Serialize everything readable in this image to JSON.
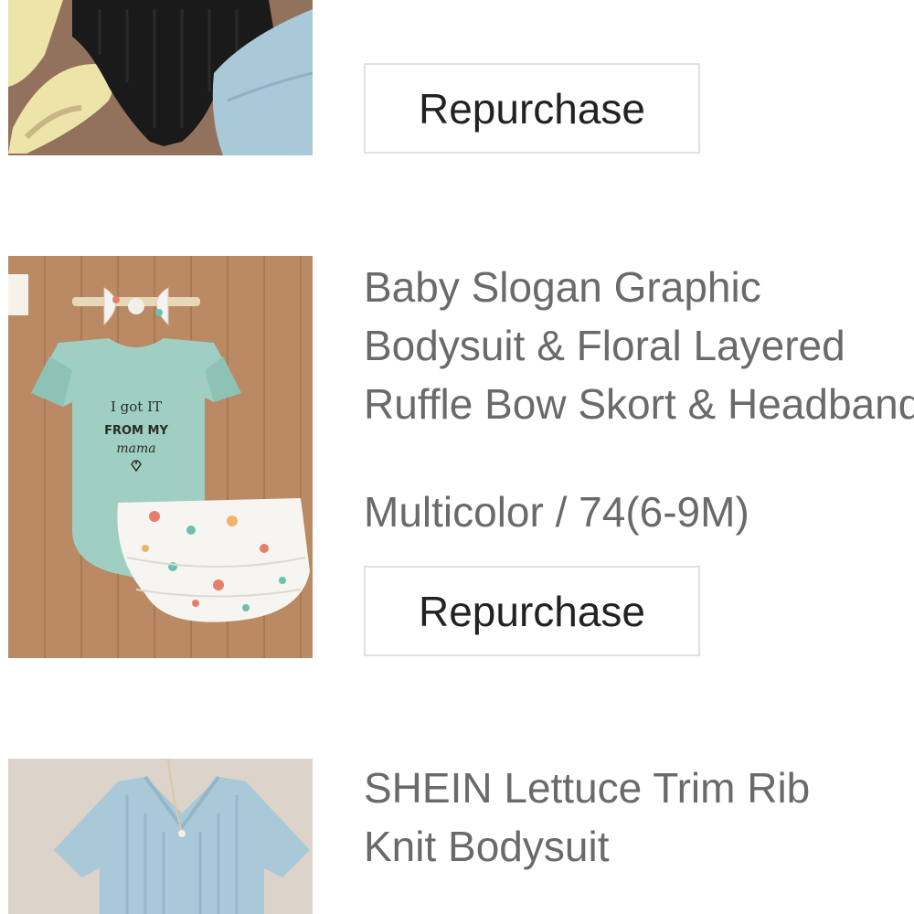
{
  "orders": [
    {
      "image_icon": "black-bodysuit-with-sandals-and-jeans",
      "repurchase_label": "Repurchase"
    },
    {
      "image_icon": "mint-romper-floral-skort-headband",
      "image_print": [
        "I got IT",
        "FROM MY",
        "mama"
      ],
      "title_lines": [
        "Baby Slogan Graphic",
        "Bodysuit & Floral Layered",
        "Ruffle Bow Skort & Headband"
      ],
      "variant": "Multicolor / 74(6-9M)",
      "repurchase_label": "Repurchase"
    },
    {
      "image_icon": "blue-rib-knit-bodysuit",
      "title_lines": [
        "SHEIN Lettuce Trim Rib",
        "Knit Bodysuit"
      ]
    }
  ],
  "colors": {
    "text": "#6a6a6a",
    "button_text": "#222222",
    "button_border": "#e1e1e1",
    "wood": "#b98a63",
    "mint": "#9fcfc2",
    "denim": "#a9c8d8"
  }
}
